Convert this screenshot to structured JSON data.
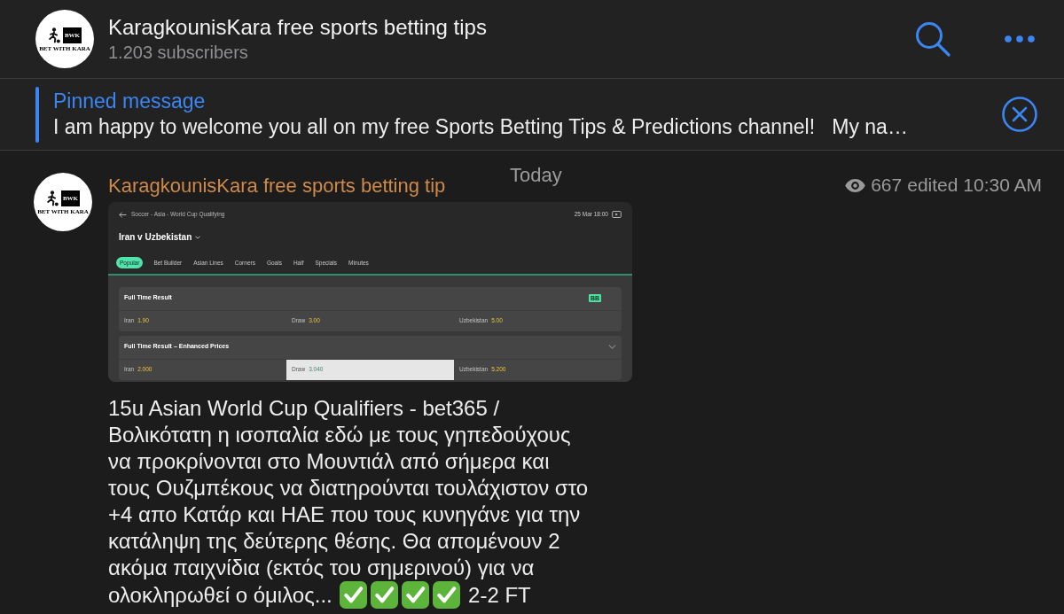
{
  "channel": {
    "avatar": {
      "badge": "BWK",
      "caption": "BET WITH KARA"
    },
    "title": "KaragkounisKara free sports betting tips",
    "subscribers": "1.203 subscribers"
  },
  "pinned": {
    "label": "Pinned message",
    "text": "I am happy to welcome you all on my free Sports Betting Tips & Predictions channel!   My na…"
  },
  "date_header": "Today",
  "message": {
    "avatar": {
      "badge": "BWK",
      "caption": "BET WITH KARA"
    },
    "author": "KaragkounisKara free sports betting tip",
    "views": "667",
    "status": "edited 10:30 AM",
    "screenshot": {
      "breadcrumb": "Soccer - Asia - World Cup Qualifying",
      "kickoff": "25 Mar 18:00",
      "match": "Iran v Uzbekistan",
      "tabs": [
        {
          "label": "Popular",
          "selected": true
        },
        {
          "label": "Bet Builder",
          "selected": false
        },
        {
          "label": "Asian Lines",
          "selected": false
        },
        {
          "label": "Corners",
          "selected": false
        },
        {
          "label": "Goals",
          "selected": false
        },
        {
          "label": "Half",
          "selected": false
        },
        {
          "label": "Specials",
          "selected": false
        },
        {
          "label": "Minutes",
          "selected": false
        }
      ],
      "markets": [
        {
          "title": "Full Time Result",
          "badge": "BB",
          "collapsible": false,
          "odds": [
            {
              "label": "Iran",
              "price": "1.90",
              "selected": false
            },
            {
              "label": "Draw",
              "price": "3.00",
              "selected": false
            },
            {
              "label": "Uzbekistan",
              "price": "5.00",
              "selected": false
            }
          ]
        },
        {
          "title": "Full Time Result – Enhanced Prices",
          "collapsible": true,
          "odds": [
            {
              "label": "Iran",
              "price": "2.000",
              "selected": false
            },
            {
              "label": "Draw",
              "price": "3.040",
              "selected": true
            },
            {
              "label": "Uzbekistan",
              "price": "5.200",
              "selected": false
            }
          ]
        }
      ]
    },
    "text": "15u Asian World Cup Qualifiers - bet365 / Βολικότατη η ισοπαλία εδώ με τους γηπεδούχους να προκρίνονται στο Μουντιάλ από σήμερα και τους Ουζμπέκους να διατηρούνται τουλάχιστον στο +4 απο Κατάρ και ΗΑΕ που τους κυνηγάνε για την κατάληψη της δεύτερης θέσης. Θα απομένουν 2 ακόμα παιχνίδια (εκτός του σημερινού) για να ολοκληρωθεί ο όμιλος...",
    "emoji": [
      {
        "kind": "check"
      },
      {
        "kind": "check"
      },
      {
        "kind": "check"
      },
      {
        "kind": "check"
      }
    ],
    "result": "2-2 FT"
  }
}
